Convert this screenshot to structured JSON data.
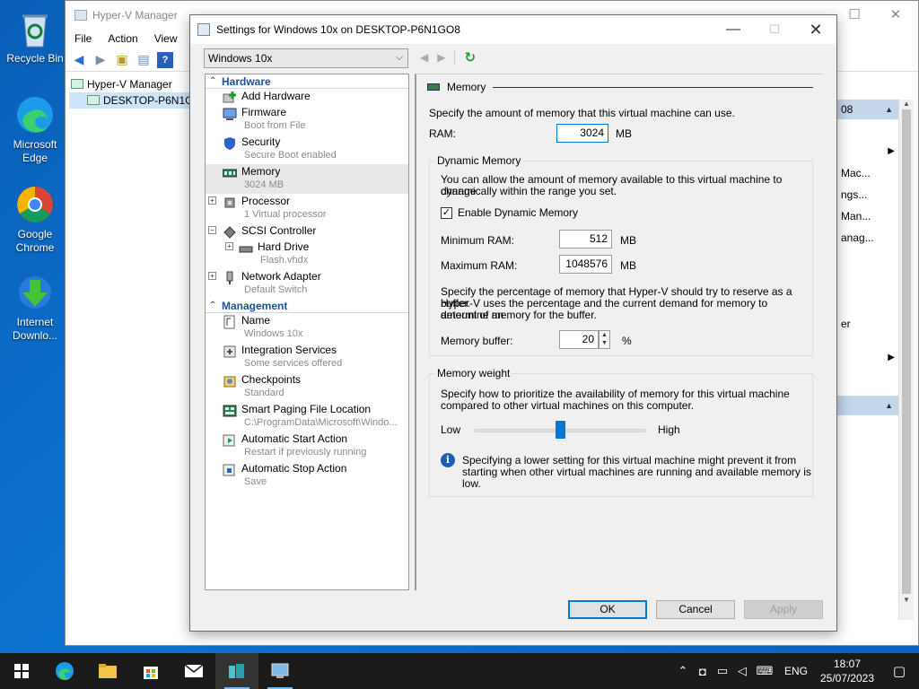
{
  "desktop": {
    "icons": [
      {
        "label": "Recycle Bin"
      },
      {
        "label": "Microsoft Edge"
      },
      {
        "label": "Google Chrome"
      },
      {
        "label": "Internet Downlo..."
      }
    ]
  },
  "hyperv": {
    "title": "Hyper-V Manager",
    "menu": [
      "File",
      "Action",
      "View"
    ],
    "tree": {
      "root": "Hyper-V Manager",
      "host": "DESKTOP-P6N1GO8"
    },
    "actions_header": "08",
    "actions": [
      "Mac...",
      "ngs...",
      "Man...",
      "anag...",
      "er"
    ]
  },
  "dialog": {
    "title": "Settings for Windows 10x on DESKTOP-P6N1GO8",
    "vm_name": "Windows 10x",
    "sections": {
      "hardware": "Hardware",
      "management": "Management"
    },
    "hardware_items": [
      {
        "name": "Add Hardware",
        "sub": ""
      },
      {
        "name": "Firmware",
        "sub": "Boot from File"
      },
      {
        "name": "Security",
        "sub": "Secure Boot enabled"
      },
      {
        "name": "Memory",
        "sub": "3024 MB"
      },
      {
        "name": "Processor",
        "sub": "1 Virtual processor"
      },
      {
        "name": "SCSI Controller",
        "sub": ""
      },
      {
        "name": "Hard Drive",
        "sub": "Flash.vhdx"
      },
      {
        "name": "Network Adapter",
        "sub": "Default Switch"
      }
    ],
    "management_items": [
      {
        "name": "Name",
        "sub": "Windows 10x"
      },
      {
        "name": "Integration Services",
        "sub": "Some services offered"
      },
      {
        "name": "Checkpoints",
        "sub": "Standard"
      },
      {
        "name": "Smart Paging File Location",
        "sub": "C:\\ProgramData\\Microsoft\\Windo..."
      },
      {
        "name": "Automatic Start Action",
        "sub": "Restart if previously running"
      },
      {
        "name": "Automatic Stop Action",
        "sub": "Save"
      }
    ],
    "memory": {
      "header": "Memory",
      "intro": "Specify the amount of memory that this virtual machine can use.",
      "ram_label": "RAM:",
      "ram_value": "3024",
      "unit": "MB",
      "dynamic": {
        "label": "Dynamic Memory",
        "desc_line1": "You can allow the amount of memory available to this virtual machine to change",
        "desc_line2": "dynamically within the range you set.",
        "enable_label": "Enable Dynamic Memory",
        "enabled": true,
        "min_label": "Minimum RAM:",
        "min_value": "512",
        "max_label": "Maximum RAM:",
        "max_value": "1048576",
        "buffer_desc_line1": "Specify the percentage of memory that Hyper-V should try to reserve as a buffer.",
        "buffer_desc_line2": "Hyper-V uses the percentage and the current demand for memory to determine an",
        "buffer_desc_line3": "amount of memory for the buffer.",
        "buffer_label": "Memory buffer:",
        "buffer_value": "20",
        "buffer_unit": "%"
      },
      "weight": {
        "label": "Memory weight",
        "desc_line1": "Specify how to prioritize the availability of memory for this virtual machine",
        "desc_line2": "compared to other virtual machines on this computer.",
        "low": "Low",
        "high": "High",
        "level": 0.5,
        "info_line1": "Specifying a lower setting for this virtual machine might prevent it from",
        "info_line2": "starting when other virtual machines are running and available memory is low."
      }
    },
    "buttons": {
      "ok": "OK",
      "cancel": "Cancel",
      "apply": "Apply"
    }
  },
  "taskbar": {
    "lang": "ENG",
    "time": "18:07",
    "date": "25/07/2023"
  },
  "colors": {
    "accent": "#0078d7",
    "section": "#1e4f9c",
    "slider": "#0078d7"
  }
}
